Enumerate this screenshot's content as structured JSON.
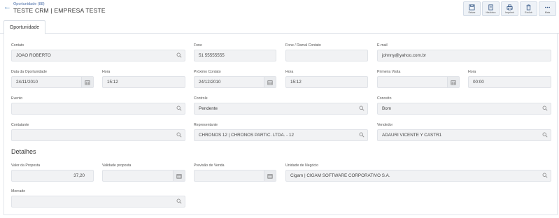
{
  "header": {
    "breadcrumb": "Oportunidade (88)",
    "title": "TESTE CRM | EMPRESA TESTE"
  },
  "toolbar": {
    "save": "Salvar",
    "history": "Histórico",
    "print": "Imprimir",
    "delete": "Excluir",
    "more": "Mais"
  },
  "tabs": {
    "oportunidade": "Oportunidade"
  },
  "fields": {
    "contato": {
      "label": "Contato",
      "value": "JOAO ROBERTO"
    },
    "fone": {
      "label": "Fone",
      "value": "51 55555555"
    },
    "fone_ramal": {
      "label": "Fone / Ramal Contato",
      "value": ""
    },
    "email": {
      "label": "E-mail",
      "value": "johnny@yahoo.com.br"
    },
    "data_oportunidade": {
      "label": "Data da Oportunidade",
      "value": "24/11/2010"
    },
    "hora1": {
      "label": "Hora",
      "value": "15:12"
    },
    "proximo_contato": {
      "label": "Próximo Contato",
      "value": "24/12/2010"
    },
    "hora2": {
      "label": "Hora",
      "value": "15:12"
    },
    "primeira_visita": {
      "label": "Primeira Visita",
      "value": ""
    },
    "hora3": {
      "label": "Hora",
      "value": "00:00"
    },
    "evento": {
      "label": "Evento",
      "value": ""
    },
    "controle": {
      "label": "Controle",
      "value": "Pendente"
    },
    "conceito": {
      "label": "Conceito",
      "value": "Bom"
    },
    "contatante": {
      "label": "Contatante",
      "value": ""
    },
    "representante": {
      "label": "Representante",
      "value": "CHRONOS 12 | CHRONOS PARTIC. LTDA. - 12"
    },
    "vendedor": {
      "label": "Vendedor",
      "value": "ADAURI VICENTE Y CASTR1"
    },
    "valor_proposta": {
      "label": "Valor da Proposta",
      "value": "37,20"
    },
    "validade_proposta": {
      "label": "Validade proposta",
      "value": ""
    },
    "previsao_venda": {
      "label": "Previsão de Venda",
      "value": ""
    },
    "unidade_negocio": {
      "label": "Unidade de Negócio",
      "value": "Cigam | CIGAM SOFTWARE CORPORATIVO S.A."
    },
    "mercado": {
      "label": "Mercado",
      "value": ""
    }
  },
  "sections": {
    "detalhes": "Detalhes"
  },
  "icons": {
    "back": "back-arrow-icon",
    "search": "search-icon",
    "calendar": "calendar-icon"
  },
  "colors": {
    "accent": "#2b6cb0",
    "field_bg": "#f1f2f4"
  }
}
